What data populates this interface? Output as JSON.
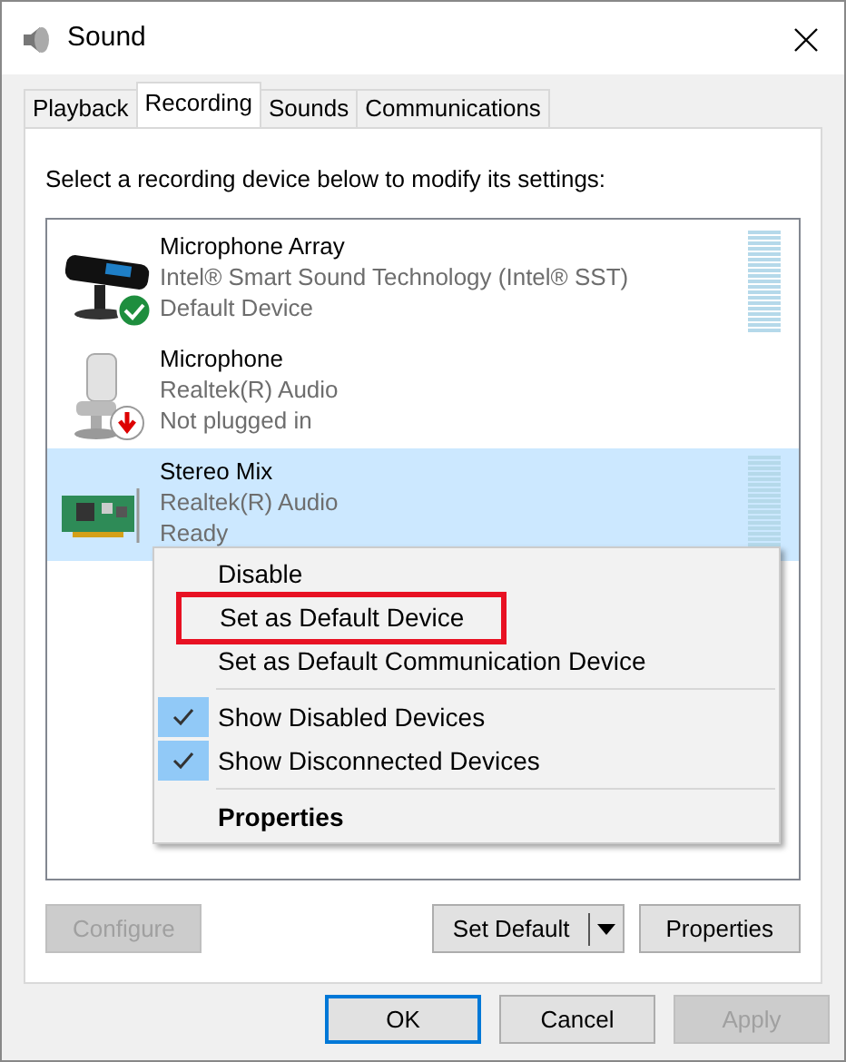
{
  "window": {
    "title": "Sound"
  },
  "tabs": [
    {
      "label": "Playback",
      "selected": false
    },
    {
      "label": "Recording",
      "selected": true
    },
    {
      "label": "Sounds",
      "selected": false
    },
    {
      "label": "Communications",
      "selected": false
    }
  ],
  "instruction": "Select a recording device below to modify its settings:",
  "devices": [
    {
      "name": "Microphone Array",
      "driver": "Intel® Smart Sound Technology (Intel® SST)",
      "status": "Default Device",
      "kind": "mic-array",
      "default_device": true,
      "unplugged": false,
      "meter": true,
      "selected": false
    },
    {
      "name": "Microphone",
      "driver": "Realtek(R) Audio",
      "status": "Not plugged in",
      "kind": "microphone",
      "default_device": false,
      "unplugged": true,
      "meter": false,
      "selected": false
    },
    {
      "name": "Stereo Mix",
      "driver": "Realtek(R) Audio",
      "status": "Ready",
      "kind": "sound-card",
      "default_device": false,
      "unplugged": false,
      "meter": true,
      "selected": true
    }
  ],
  "context_menu": [
    {
      "kind": "item",
      "label": "Disable",
      "checked": false,
      "default": false,
      "highlighted": false
    },
    {
      "kind": "item",
      "label": "Set as Default Device",
      "checked": false,
      "default": false,
      "highlighted": true
    },
    {
      "kind": "item",
      "label": "Set as Default Communication Device",
      "checked": false,
      "default": false,
      "highlighted": false
    },
    {
      "kind": "separator"
    },
    {
      "kind": "item",
      "label": "Show Disabled Devices",
      "checked": true,
      "default": false,
      "highlighted": false
    },
    {
      "kind": "item",
      "label": "Show Disconnected Devices",
      "checked": true,
      "default": false,
      "highlighted": false
    },
    {
      "kind": "separator"
    },
    {
      "kind": "item",
      "label": "Properties",
      "checked": false,
      "default": true,
      "highlighted": false
    }
  ],
  "tab_buttons": [
    {
      "label": "Configure",
      "kind": "plain",
      "disabled": true
    },
    {
      "label": "Set Default",
      "kind": "split",
      "disabled": false
    },
    {
      "label": "Properties",
      "kind": "plain",
      "disabled": false
    }
  ],
  "dialog_buttons": [
    {
      "label": "OK",
      "disabled": false,
      "focused": true
    },
    {
      "label": "Cancel",
      "disabled": false,
      "focused": false
    },
    {
      "label": "Apply",
      "disabled": true,
      "focused": false
    }
  ]
}
